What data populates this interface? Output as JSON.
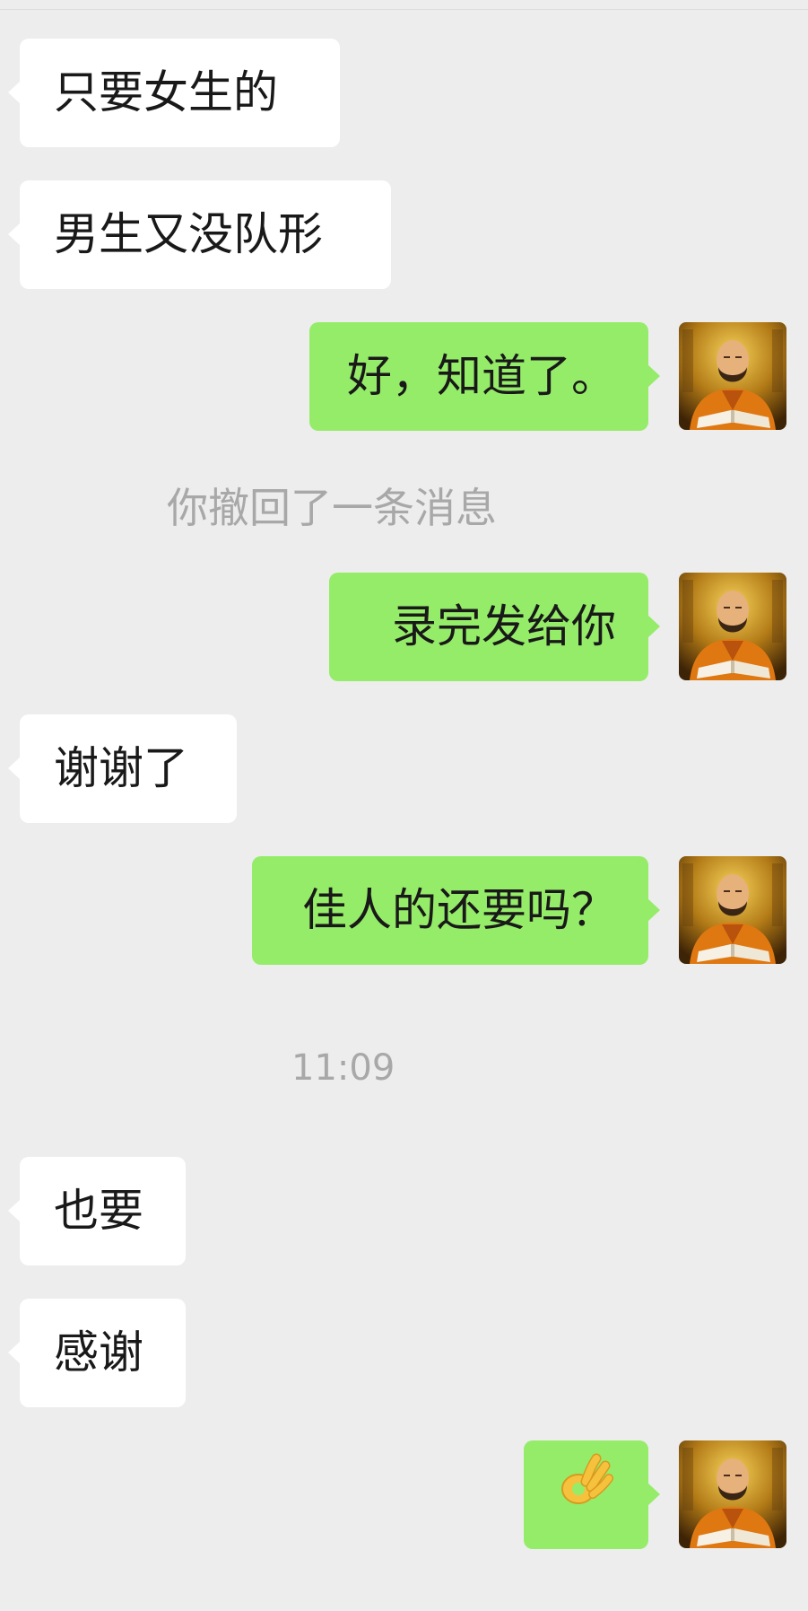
{
  "chat": {
    "system": {
      "recall_notice": "你撤回了一条消息",
      "timestamp": "11:09"
    },
    "messages": [
      {
        "side": "received",
        "text": "只要女生的"
      },
      {
        "side": "received",
        "text": "男生又没队形"
      },
      {
        "side": "sent",
        "text": "好，知道了。"
      },
      {
        "side": "sent",
        "text": "录完发给你"
      },
      {
        "side": "received",
        "text": "谢谢了"
      },
      {
        "side": "sent",
        "text": "佳人的还要吗？"
      },
      {
        "side": "received",
        "text": "也要"
      },
      {
        "side": "received",
        "text": "感谢"
      },
      {
        "side": "sent",
        "emoji": "ok-hand"
      }
    ]
  },
  "colors": {
    "background": "#ededed",
    "sent_bubble": "#95ec69",
    "received_bubble": "#ffffff",
    "system_text": "#a8a8a8"
  },
  "icons": {
    "self_avatar": "avatar-photo",
    "ok_emoji": "ok-hand-emoji"
  }
}
